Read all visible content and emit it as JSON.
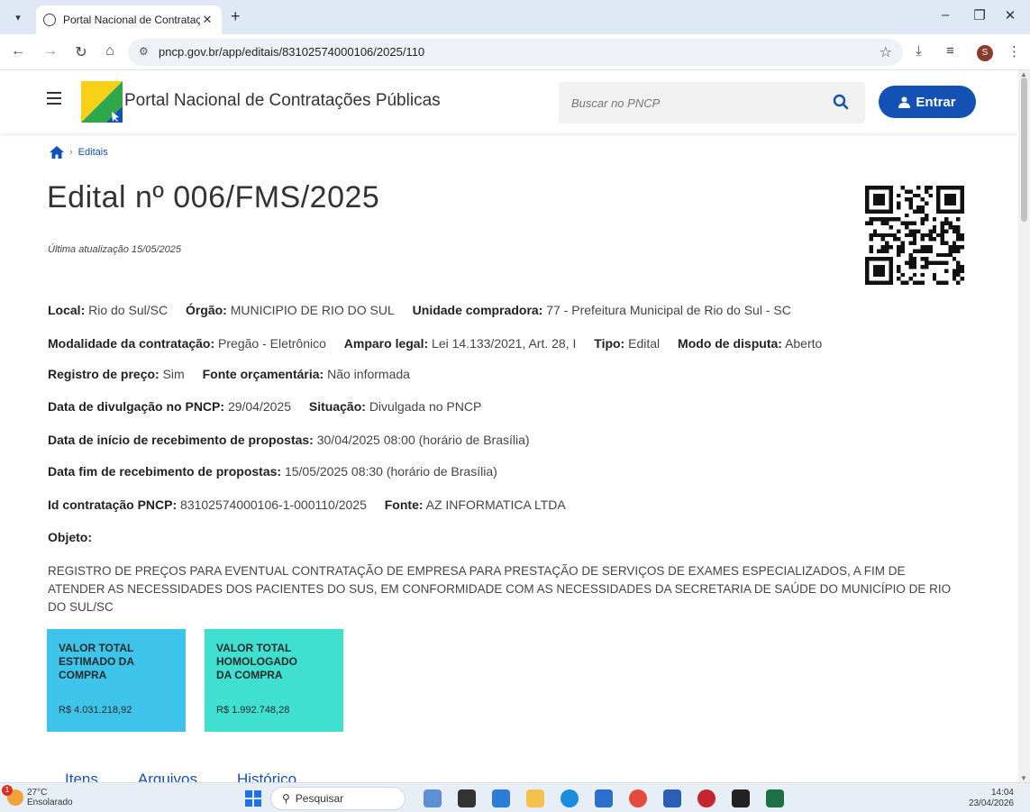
{
  "browser": {
    "tab_title": "Portal Nacional de Contrataçõe",
    "url": "pncp.gov.br/app/editais/83102574000106/2025/110",
    "profile_initial": "S"
  },
  "header": {
    "site_title": "Portal Nacional de Contratações Públicas",
    "search_placeholder": "Buscar no PNCP",
    "login_label": "Entrar"
  },
  "breadcrumb": {
    "current": "Editais"
  },
  "edital": {
    "title": "Edital nº 006/FMS/2025",
    "last_update": "Última atualização 15/05/2025",
    "lines": [
      [
        {
          "label": "Local:",
          "value": "Rio do Sul/SC"
        },
        {
          "label": "Órgão:",
          "value": "MUNICIPIO DE RIO DO SUL"
        },
        {
          "label": "Unidade compradora:",
          "value": "77 - Prefeitura Municipal de Rio do Sul - SC"
        }
      ],
      [
        {
          "label": "Modalidade da contratação:",
          "value": "Pregão - Eletrônico"
        },
        {
          "label": "Amparo legal:",
          "value": "Lei 14.133/2021, Art. 28, I"
        },
        {
          "label": "Tipo:",
          "value": "Edital"
        },
        {
          "label": "Modo de disputa:",
          "value": "Aberto"
        }
      ],
      [
        {
          "label": "Registro de preço:",
          "value": "Sim"
        },
        {
          "label": "Fonte orçamentária:",
          "value": "Não informada"
        }
      ],
      [
        {
          "label": "Data de divulgação no PNCP:",
          "value": "29/04/2025"
        },
        {
          "label": "Situação:",
          "value": "Divulgada no PNCP"
        }
      ],
      [
        {
          "label": "Data de início de recebimento de propostas:",
          "value": "30/04/2025 08:00 (horário de Brasília)"
        }
      ],
      [
        {
          "label": "Data fim de recebimento de propostas:",
          "value": "15/05/2025 08:30 (horário de Brasília)"
        }
      ],
      [
        {
          "label": "Id contratação PNCP:",
          "value": "83102574000106-1-000110/2025"
        },
        {
          "label": "Fonte:",
          "value": "AZ INFORMATICA LTDA"
        }
      ]
    ],
    "objeto_label": "Objeto:",
    "objeto_text": "REGISTRO DE PREÇOS PARA EVENTUAL CONTRATAÇÃO DE EMPRESA PARA PRESTAÇÃO DE SERVIÇOS DE EXAMES ESPECIALIZADOS, A FIM DE ATENDER AS NECESSIDADES DOS PACIENTES DO SUS, EM CONFORMIDADE COM AS NECESSIDADES DA SECRETARIA DE SAÚDE DO MUNICÍPIO DE RIO DO SUL/SC",
    "cards": {
      "estimado_label": "VALOR TOTAL ESTIMADO DA COMPRA",
      "estimado_value": "R$ 4.031.218,92",
      "homologado_label": "VALOR TOTAL HOMOLOGADO DA COMPRA",
      "homologado_value": "R$ 1.992.748,28"
    },
    "tabs": [
      "Itens",
      "Arquivos",
      "Histórico"
    ]
  },
  "taskbar": {
    "temp": "27°C",
    "weather": "Ensolarado",
    "weather_badge": "1",
    "search_label": "Pesquisar",
    "time": "14:04",
    "date": "23/04/2026"
  },
  "colors": {
    "primary": "#1351b4",
    "card_estimado": "#3ec3ea",
    "card_homologado": "#3fe0cf"
  }
}
